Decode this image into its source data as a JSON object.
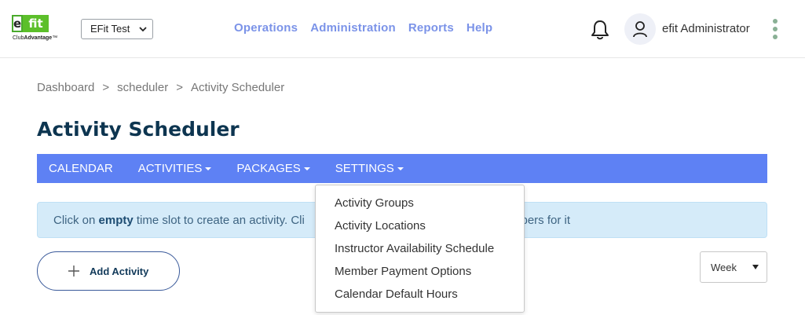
{
  "header": {
    "logo": {
      "mark_left": "e",
      "mark_right": "fit",
      "sub_prefix": "Club",
      "sub_bold": "Advantage",
      "sub_tm": "™"
    },
    "club_select": {
      "value": "EFit Test"
    },
    "nav": [
      "Operations",
      "Administration",
      "Reports",
      "Help"
    ],
    "user": {
      "name": "efit Administrator"
    },
    "icons": {
      "notifications": "bell-icon",
      "avatar": "user-icon",
      "more": "kebab-icon"
    }
  },
  "breadcrumb": [
    "Dashboard",
    "scheduler",
    "Activity Scheduler"
  ],
  "breadcrumb_sep": ">",
  "page_title": "Activity Scheduler",
  "subnav": {
    "items": [
      "CALENDAR",
      "ACTIVITIES",
      "PACKAGES",
      "SETTINGS"
    ]
  },
  "info": {
    "prefix": "Click on ",
    "bold": "empty",
    "suffix": " time slot to create an activity. Cli",
    "tail": "mbers for it"
  },
  "settings_menu": {
    "options": [
      "Activity Groups",
      "Activity Locations",
      "Instructor Availability Schedule",
      "Member Payment Options",
      "Calendar Default Hours"
    ]
  },
  "add_activity": {
    "label": "Add Activity"
  },
  "view_select": {
    "value": "Week"
  },
  "colors": {
    "nav_bar": "#5e81f4",
    "top_link": "#7b93e8",
    "title": "#0d3550",
    "info_bg": "#d5ebf9",
    "logo_green": "#5cbf2a"
  }
}
